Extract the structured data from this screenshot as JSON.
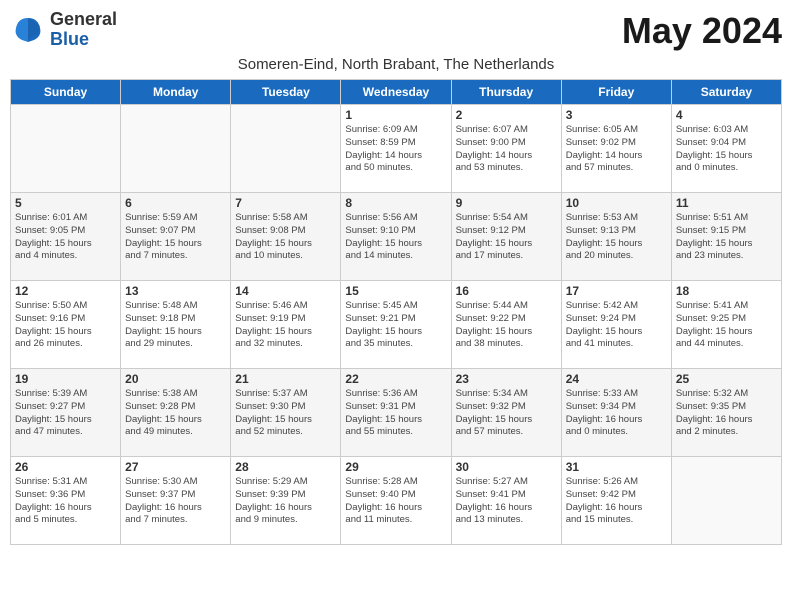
{
  "logo": {
    "general": "General",
    "blue": "Blue"
  },
  "title": "May 2024",
  "subtitle": "Someren-Eind, North Brabant, The Netherlands",
  "days_of_week": [
    "Sunday",
    "Monday",
    "Tuesday",
    "Wednesday",
    "Thursday",
    "Friday",
    "Saturday"
  ],
  "weeks": [
    [
      {
        "day": "",
        "info": ""
      },
      {
        "day": "",
        "info": ""
      },
      {
        "day": "",
        "info": ""
      },
      {
        "day": "1",
        "info": "Sunrise: 6:09 AM\nSunset: 8:59 PM\nDaylight: 14 hours\nand 50 minutes."
      },
      {
        "day": "2",
        "info": "Sunrise: 6:07 AM\nSunset: 9:00 PM\nDaylight: 14 hours\nand 53 minutes."
      },
      {
        "day": "3",
        "info": "Sunrise: 6:05 AM\nSunset: 9:02 PM\nDaylight: 14 hours\nand 57 minutes."
      },
      {
        "day": "4",
        "info": "Sunrise: 6:03 AM\nSunset: 9:04 PM\nDaylight: 15 hours\nand 0 minutes."
      }
    ],
    [
      {
        "day": "5",
        "info": "Sunrise: 6:01 AM\nSunset: 9:05 PM\nDaylight: 15 hours\nand 4 minutes."
      },
      {
        "day": "6",
        "info": "Sunrise: 5:59 AM\nSunset: 9:07 PM\nDaylight: 15 hours\nand 7 minutes."
      },
      {
        "day": "7",
        "info": "Sunrise: 5:58 AM\nSunset: 9:08 PM\nDaylight: 15 hours\nand 10 minutes."
      },
      {
        "day": "8",
        "info": "Sunrise: 5:56 AM\nSunset: 9:10 PM\nDaylight: 15 hours\nand 14 minutes."
      },
      {
        "day": "9",
        "info": "Sunrise: 5:54 AM\nSunset: 9:12 PM\nDaylight: 15 hours\nand 17 minutes."
      },
      {
        "day": "10",
        "info": "Sunrise: 5:53 AM\nSunset: 9:13 PM\nDaylight: 15 hours\nand 20 minutes."
      },
      {
        "day": "11",
        "info": "Sunrise: 5:51 AM\nSunset: 9:15 PM\nDaylight: 15 hours\nand 23 minutes."
      }
    ],
    [
      {
        "day": "12",
        "info": "Sunrise: 5:50 AM\nSunset: 9:16 PM\nDaylight: 15 hours\nand 26 minutes."
      },
      {
        "day": "13",
        "info": "Sunrise: 5:48 AM\nSunset: 9:18 PM\nDaylight: 15 hours\nand 29 minutes."
      },
      {
        "day": "14",
        "info": "Sunrise: 5:46 AM\nSunset: 9:19 PM\nDaylight: 15 hours\nand 32 minutes."
      },
      {
        "day": "15",
        "info": "Sunrise: 5:45 AM\nSunset: 9:21 PM\nDaylight: 15 hours\nand 35 minutes."
      },
      {
        "day": "16",
        "info": "Sunrise: 5:44 AM\nSunset: 9:22 PM\nDaylight: 15 hours\nand 38 minutes."
      },
      {
        "day": "17",
        "info": "Sunrise: 5:42 AM\nSunset: 9:24 PM\nDaylight: 15 hours\nand 41 minutes."
      },
      {
        "day": "18",
        "info": "Sunrise: 5:41 AM\nSunset: 9:25 PM\nDaylight: 15 hours\nand 44 minutes."
      }
    ],
    [
      {
        "day": "19",
        "info": "Sunrise: 5:39 AM\nSunset: 9:27 PM\nDaylight: 15 hours\nand 47 minutes."
      },
      {
        "day": "20",
        "info": "Sunrise: 5:38 AM\nSunset: 9:28 PM\nDaylight: 15 hours\nand 49 minutes."
      },
      {
        "day": "21",
        "info": "Sunrise: 5:37 AM\nSunset: 9:30 PM\nDaylight: 15 hours\nand 52 minutes."
      },
      {
        "day": "22",
        "info": "Sunrise: 5:36 AM\nSunset: 9:31 PM\nDaylight: 15 hours\nand 55 minutes."
      },
      {
        "day": "23",
        "info": "Sunrise: 5:34 AM\nSunset: 9:32 PM\nDaylight: 15 hours\nand 57 minutes."
      },
      {
        "day": "24",
        "info": "Sunrise: 5:33 AM\nSunset: 9:34 PM\nDaylight: 16 hours\nand 0 minutes."
      },
      {
        "day": "25",
        "info": "Sunrise: 5:32 AM\nSunset: 9:35 PM\nDaylight: 16 hours\nand 2 minutes."
      }
    ],
    [
      {
        "day": "26",
        "info": "Sunrise: 5:31 AM\nSunset: 9:36 PM\nDaylight: 16 hours\nand 5 minutes."
      },
      {
        "day": "27",
        "info": "Sunrise: 5:30 AM\nSunset: 9:37 PM\nDaylight: 16 hours\nand 7 minutes."
      },
      {
        "day": "28",
        "info": "Sunrise: 5:29 AM\nSunset: 9:39 PM\nDaylight: 16 hours\nand 9 minutes."
      },
      {
        "day": "29",
        "info": "Sunrise: 5:28 AM\nSunset: 9:40 PM\nDaylight: 16 hours\nand 11 minutes."
      },
      {
        "day": "30",
        "info": "Sunrise: 5:27 AM\nSunset: 9:41 PM\nDaylight: 16 hours\nand 13 minutes."
      },
      {
        "day": "31",
        "info": "Sunrise: 5:26 AM\nSunset: 9:42 PM\nDaylight: 16 hours\nand 15 minutes."
      },
      {
        "day": "",
        "info": ""
      }
    ]
  ]
}
